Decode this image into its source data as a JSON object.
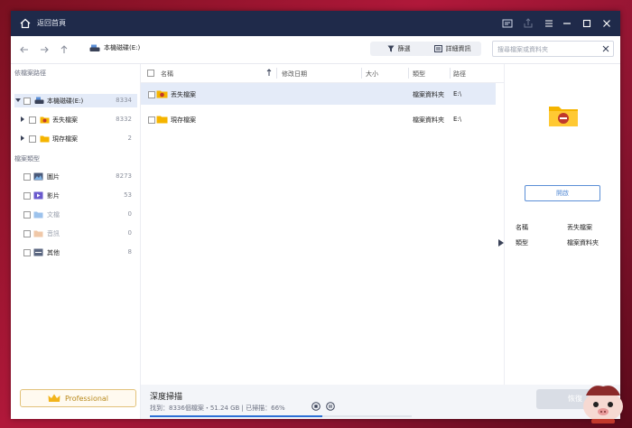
{
  "titlebar": {
    "title": "返回首頁"
  },
  "toolbar": {
    "drive": "本機磁碟(E:)",
    "filter_label": "篩選",
    "details_label": "詳細資訊",
    "search_placeholder": "搜尋檔案或資料夾"
  },
  "sidebar": {
    "path_title": "依檔案路徑",
    "type_title": "檔案類型",
    "tree": [
      {
        "label": "本機磁碟(E:)",
        "count": "8334"
      },
      {
        "label": "丟失檔案",
        "count": "8332"
      },
      {
        "label": "現存檔案",
        "count": "2"
      }
    ],
    "types": [
      {
        "label": "圖片",
        "count": "8273"
      },
      {
        "label": "影片",
        "count": "53"
      },
      {
        "label": "文檔",
        "count": "0"
      },
      {
        "label": "音訊",
        "count": "0"
      },
      {
        "label": "其他",
        "count": "8"
      }
    ],
    "pro_label": "Professional"
  },
  "table": {
    "headers": {
      "name": "名稱",
      "date": "修改日期",
      "size": "大小",
      "type": "類型",
      "path": "路徑"
    },
    "rows": [
      {
        "name": "丟失檔案",
        "date": "",
        "size": "",
        "type": "檔案資料夾",
        "path": "E:\\"
      },
      {
        "name": "現存檔案",
        "date": "",
        "size": "",
        "type": "檔案資料夾",
        "path": "E:\\"
      }
    ]
  },
  "detail": {
    "open_label": "開啟",
    "name_key": "名稱",
    "name_val": "丟失檔案",
    "type_key": "類型",
    "type_val": "檔案資料夾"
  },
  "status": {
    "title": "深度掃描",
    "line": "找到：8336個檔案・51.24 GB | 已掃描：66%",
    "progress": 0.66,
    "recover_label": "恢復"
  },
  "colors": {
    "accent": "#2b6fd6",
    "titlebar": "#1f2a4a",
    "selected_row": "#e4ebf8",
    "folder": "#f5b400"
  }
}
